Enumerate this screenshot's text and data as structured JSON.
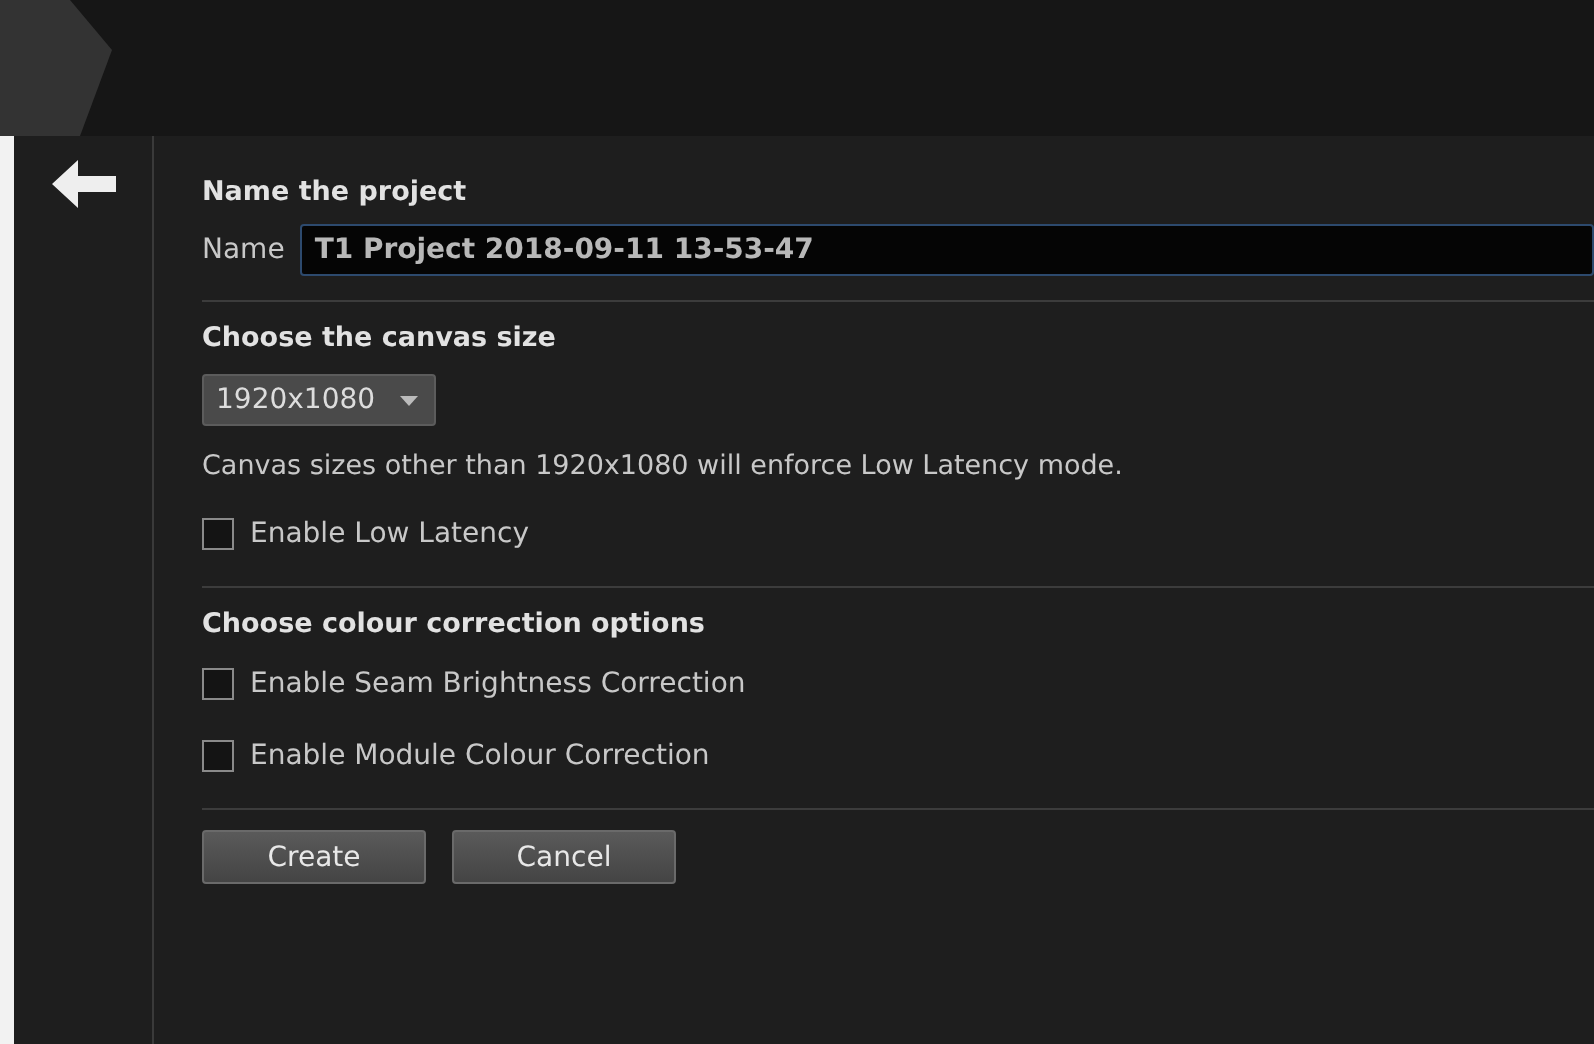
{
  "sections": [
    {
      "kind": "name",
      "title": "Name the project",
      "field_label": "Name",
      "value": "T1 Project 2018-09-11 13-53-47"
    },
    {
      "kind": "canvas",
      "title": "Choose the canvas size",
      "select": "1920x1080",
      "note": "Canvas sizes other than 1920x1080 will enforce Low Latency mode.",
      "options": [
        {
          "label": "Enable Low Latency",
          "checked": false
        }
      ]
    },
    {
      "kind": "colour",
      "title": "Choose colour correction options",
      "options": [
        {
          "label": "Enable Seam Brightness Correction",
          "checked": false
        },
        {
          "label": "Enable Module Colour Correction",
          "checked": false
        }
      ]
    }
  ],
  "buttons": [
    "Create",
    "Cancel"
  ]
}
